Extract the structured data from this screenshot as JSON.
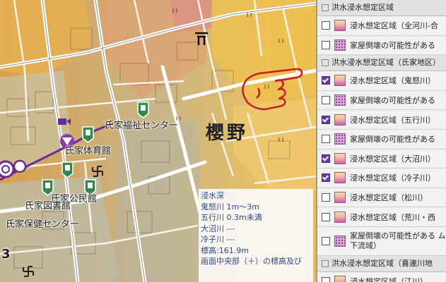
{
  "map": {
    "area_name": "櫻野",
    "labels": {
      "welfare_center": "氏家福祉センター",
      "gym": "氏家体育館",
      "community_hall": "氏家公民館",
      "library": "氏家図書館",
      "health_center": "氏家保健センター"
    },
    "corner_digit": "3",
    "colors": {
      "road": "#ffffff",
      "flood_yellow": "#f0c030",
      "flood_pink": "#d08a8a",
      "rail": "#6a2a9a"
    }
  },
  "info_box": {
    "title": "浸水深",
    "lines": [
      "鬼怒川 1m～3m",
      "五行川 0.3m未満",
      "大沼川 ---",
      "冷子川 ---",
      "標高:161.9m",
      "画面中央部（＋）の標高及び"
    ]
  },
  "panel": {
    "header": "洪水浸水想定区域",
    "sections": [
      {
        "items": [
          {
            "label": "浸水想定区域（全河川-合",
            "checked": false,
            "swatch": "gradient"
          },
          {
            "label": "家屋倒壊の可能性がある",
            "checked": false,
            "swatch": "dots"
          }
        ]
      },
      {
        "title": "洪水浸水想定区域（氏家地区）",
        "items": [
          {
            "label": "浸水想定区域（鬼怒川）",
            "checked": true,
            "swatch": "gradient"
          },
          {
            "label": "家屋倒壊の可能性がある",
            "checked": false,
            "swatch": "dots"
          },
          {
            "label": "浸水想定区域（五行川）",
            "checked": true,
            "swatch": "gradient"
          },
          {
            "label": "家屋倒壊の可能性がある",
            "checked": false,
            "swatch": "dots"
          },
          {
            "label": "浸水想定区域（大沼川）",
            "checked": true,
            "swatch": "gradient"
          },
          {
            "label": "浸水想定区域（冷子川）",
            "checked": true,
            "swatch": "gradient"
          },
          {
            "label": "浸水想定区域（松川）",
            "checked": false,
            "swatch": "gradient"
          },
          {
            "label": "浸水想定区域（荒川・西",
            "checked": false,
            "swatch": "gradient"
          },
          {
            "label": "家屋倒壊の可能性がある ム下流域）",
            "checked": false,
            "swatch": "dots",
            "tall": true
          }
        ]
      },
      {
        "title": "洪水浸水想定区域（喜連川地",
        "items": [
          {
            "label": "浸水想定区域（江川）",
            "checked": false,
            "swatch": "gradient"
          }
        ]
      }
    ]
  }
}
